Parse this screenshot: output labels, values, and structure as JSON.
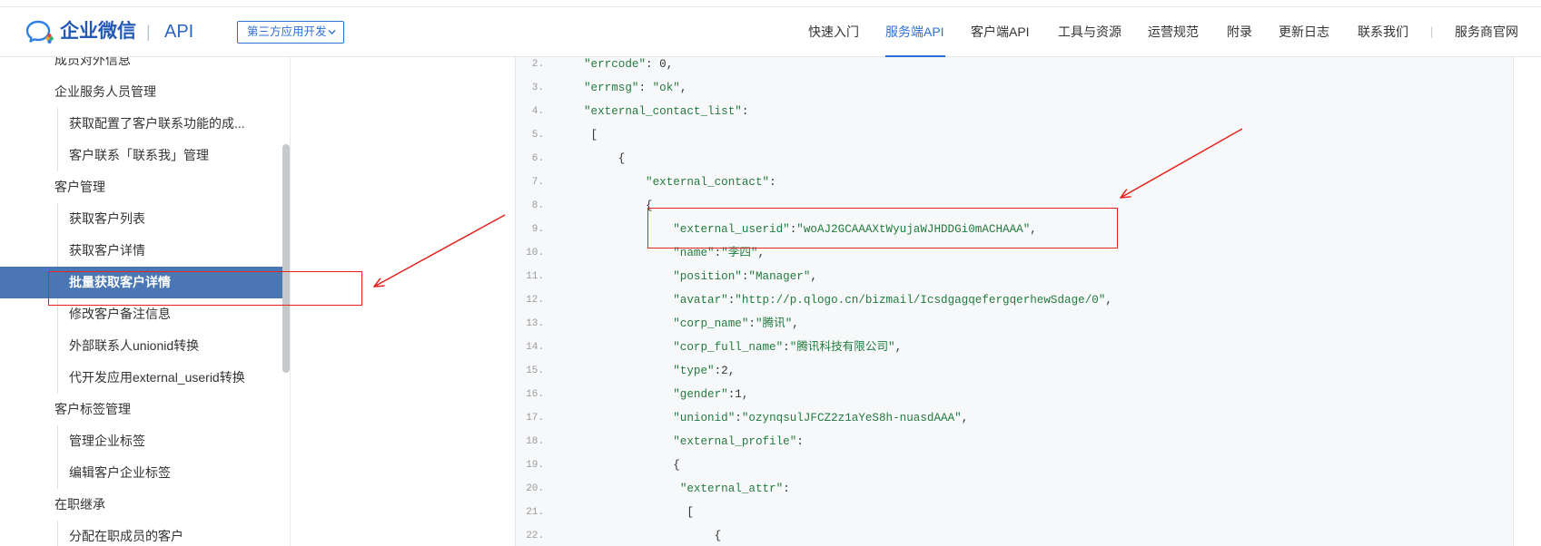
{
  "header": {
    "logo_icon": "wecom-chat-bubbles-icon",
    "logo_text": "企业微信",
    "logo_divider": "|",
    "logo_api": "API",
    "dropdown_label": "第三方应用开发",
    "dropdown_icon": "chevron-down-icon",
    "nav": [
      {
        "label": "快速入门"
      },
      {
        "label": "服务端API",
        "active": true
      },
      {
        "label": "客户端API"
      },
      {
        "label": "工具与资源"
      },
      {
        "label": "运营规范"
      },
      {
        "label": "附录"
      },
      {
        "label": "更新日志"
      },
      {
        "label": "联系我们"
      }
    ],
    "nav_divider": "|",
    "partner_link": "服务商官网"
  },
  "sidebar": {
    "items": [
      {
        "label": "成员对外信息",
        "level": 1
      },
      {
        "label": "企业服务人员管理",
        "level": 1
      },
      {
        "label": "获取配置了客户联系功能的成...",
        "level": 2
      },
      {
        "label": "客户联系「联系我」管理",
        "level": 2
      },
      {
        "label": "客户管理",
        "level": 1
      },
      {
        "label": "获取客户列表",
        "level": 2
      },
      {
        "label": "获取客户详情",
        "level": 2
      },
      {
        "label": "批量获取客户详情",
        "level": 2,
        "active": true
      },
      {
        "label": "修改客户备注信息",
        "level": 2
      },
      {
        "label": "外部联系人unionid转换",
        "level": 2
      },
      {
        "label": "代开发应用external_userid转换",
        "level": 2
      },
      {
        "label": "客户标签管理",
        "level": 1
      },
      {
        "label": "管理企业标签",
        "level": 2
      },
      {
        "label": "编辑客户企业标签",
        "level": 2
      },
      {
        "label": "在职继承",
        "level": 1
      },
      {
        "label": "分配在职成员的客户",
        "level": 2
      }
    ]
  },
  "code": {
    "lines": [
      {
        "n": "2.",
        "code": "\"errcode\": 0,"
      },
      {
        "n": "3.",
        "code": "\"errmsg\": \"ok\","
      },
      {
        "n": "4.",
        "code": "\"external_contact_list\":"
      },
      {
        "n": "5.",
        "code": " ["
      },
      {
        "n": "6.",
        "code": "     {"
      },
      {
        "n": "7.",
        "code": "         \"external_contact\":"
      },
      {
        "n": "8.",
        "code": "         {"
      },
      {
        "n": "9.",
        "code": "             \"external_userid\":\"woAJ2GCAAAXtWyujaWJHDDGi0mACHAAA\","
      },
      {
        "n": "10.",
        "code": "             \"name\":\"李四\","
      },
      {
        "n": "11.",
        "code": "             \"position\":\"Manager\","
      },
      {
        "n": "12.",
        "code": "             \"avatar\":\"http://p.qlogo.cn/bizmail/IcsdgagqefergqerhewSdage/0\","
      },
      {
        "n": "13.",
        "code": "             \"corp_name\":\"腾讯\","
      },
      {
        "n": "14.",
        "code": "             \"corp_full_name\":\"腾讯科技有限公司\","
      },
      {
        "n": "15.",
        "code": "             \"type\":2,"
      },
      {
        "n": "16.",
        "code": "             \"gender\":1,"
      },
      {
        "n": "17.",
        "code": "             \"unionid\":\"ozynqsulJFCZ2z1aYeS8h-nuasdAAA\","
      },
      {
        "n": "18.",
        "code": "             \"external_profile\":"
      },
      {
        "n": "19.",
        "code": "             {"
      },
      {
        "n": "20.",
        "code": "              \"external_attr\":"
      },
      {
        "n": "21.",
        "code": "               ["
      },
      {
        "n": "22.",
        "code": "                   {"
      }
    ]
  },
  "colors": {
    "accent": "#2f6fd6",
    "active_bg": "#4a76b4",
    "code_string": "#237a3d",
    "annotation": "#e3231c"
  }
}
